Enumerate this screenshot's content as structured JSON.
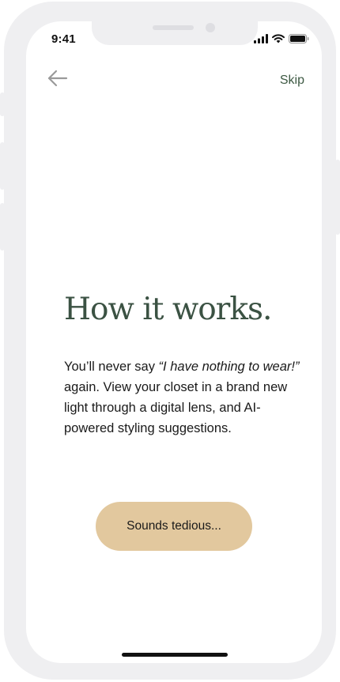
{
  "status_bar": {
    "time": "9:41"
  },
  "nav": {
    "back_icon": "arrow-left-icon",
    "skip_label": "Skip"
  },
  "content": {
    "title": "How it works.",
    "body_before": "You’ll never say ",
    "body_quote": "“I have nothing to wear!”",
    "body_after": " again. View your closet in a brand new light through a digital lens, and AI-powered styling suggestions."
  },
  "cta": {
    "label": "Sounds tedious..."
  },
  "colors": {
    "accent_green": "#3e5a44",
    "button_tan": "#e2c89e",
    "frame_gray": "#efeff1"
  }
}
